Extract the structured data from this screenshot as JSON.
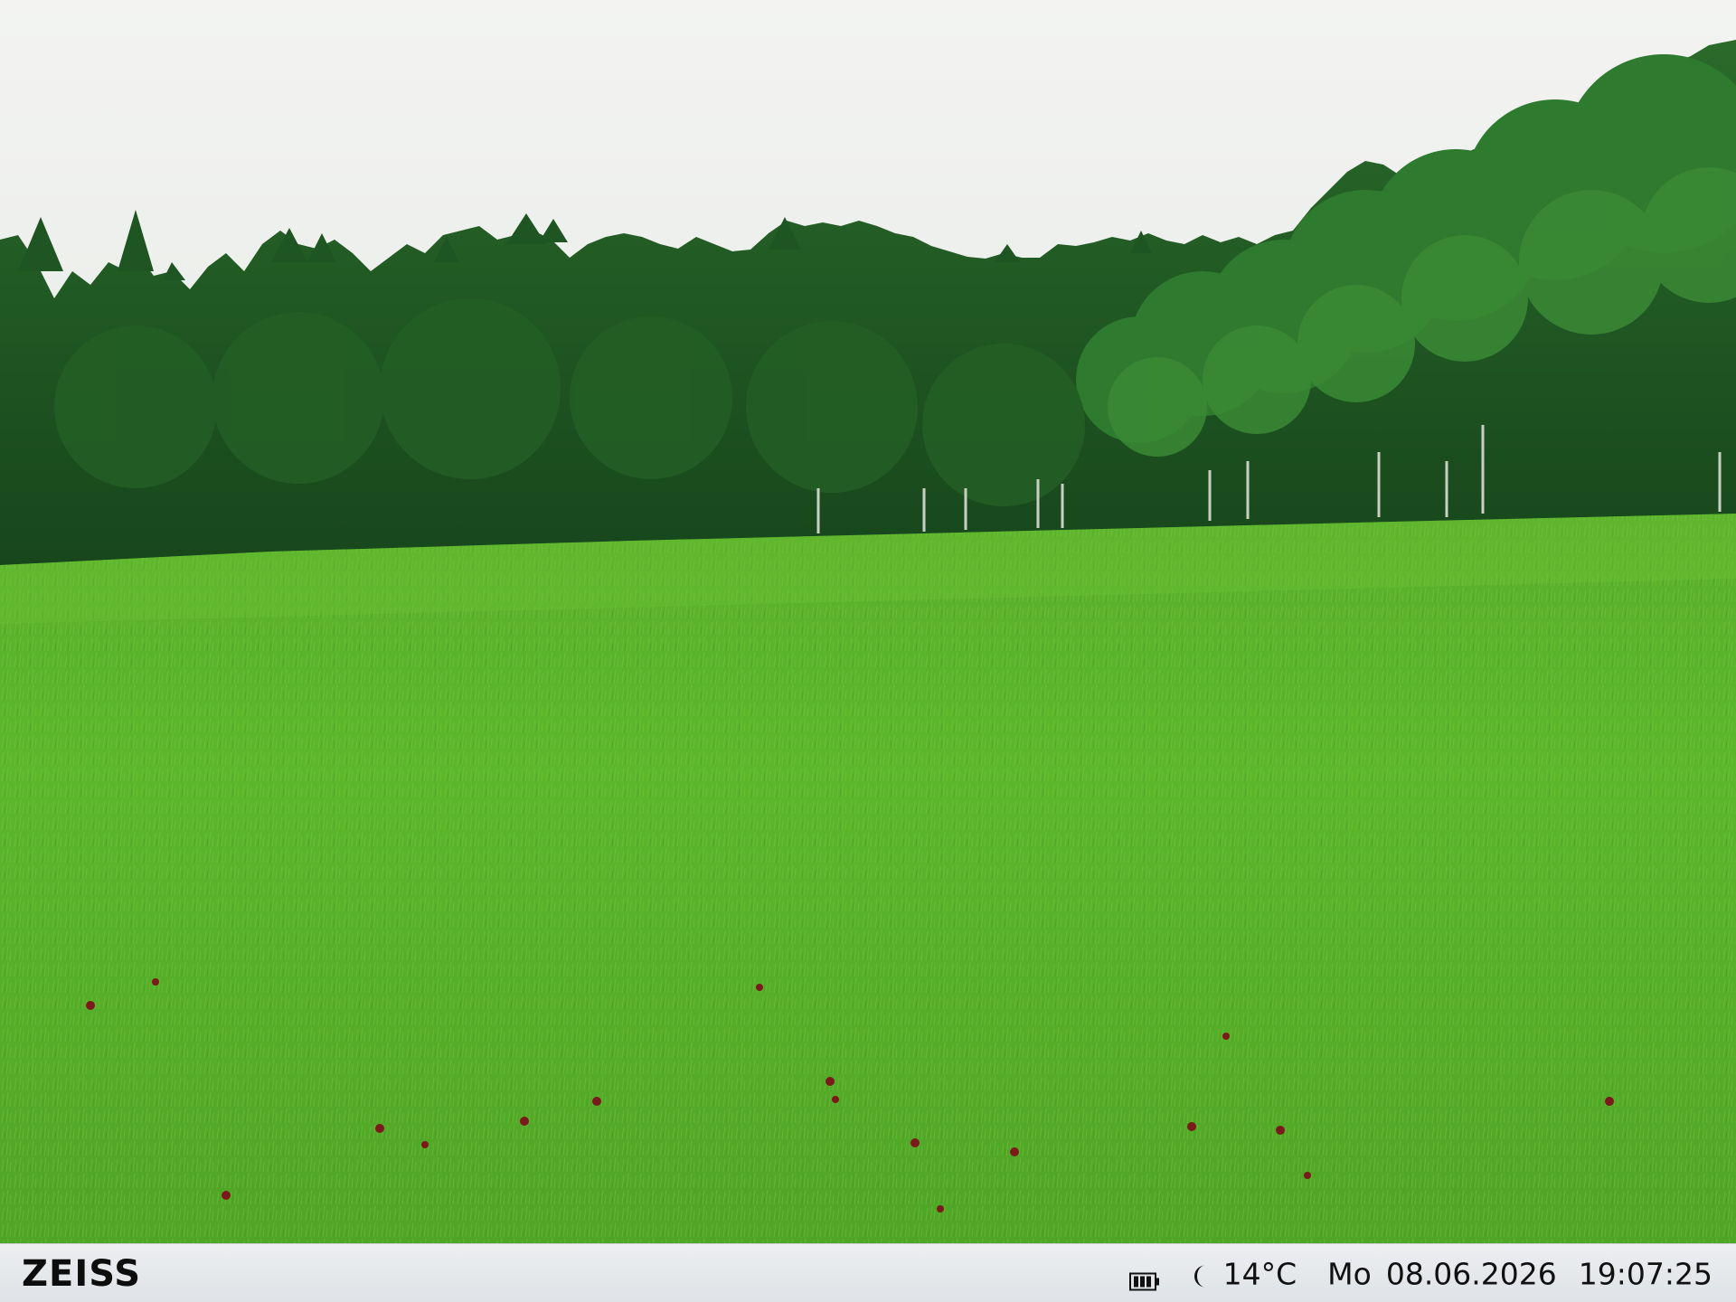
{
  "scene": {
    "description_icon": "landscape-photo",
    "sky_color": "#eef0ef",
    "forest_color": "#1f5a24",
    "meadow_color": "#5fb52d"
  },
  "info_bar": {
    "brand": "ZEISS",
    "battery_icon": "battery-icon",
    "moon_icon": "moon-icon",
    "temperature": "14°C",
    "weekday": "Mo",
    "date": "08.06.2026",
    "time": "19:07:25"
  }
}
